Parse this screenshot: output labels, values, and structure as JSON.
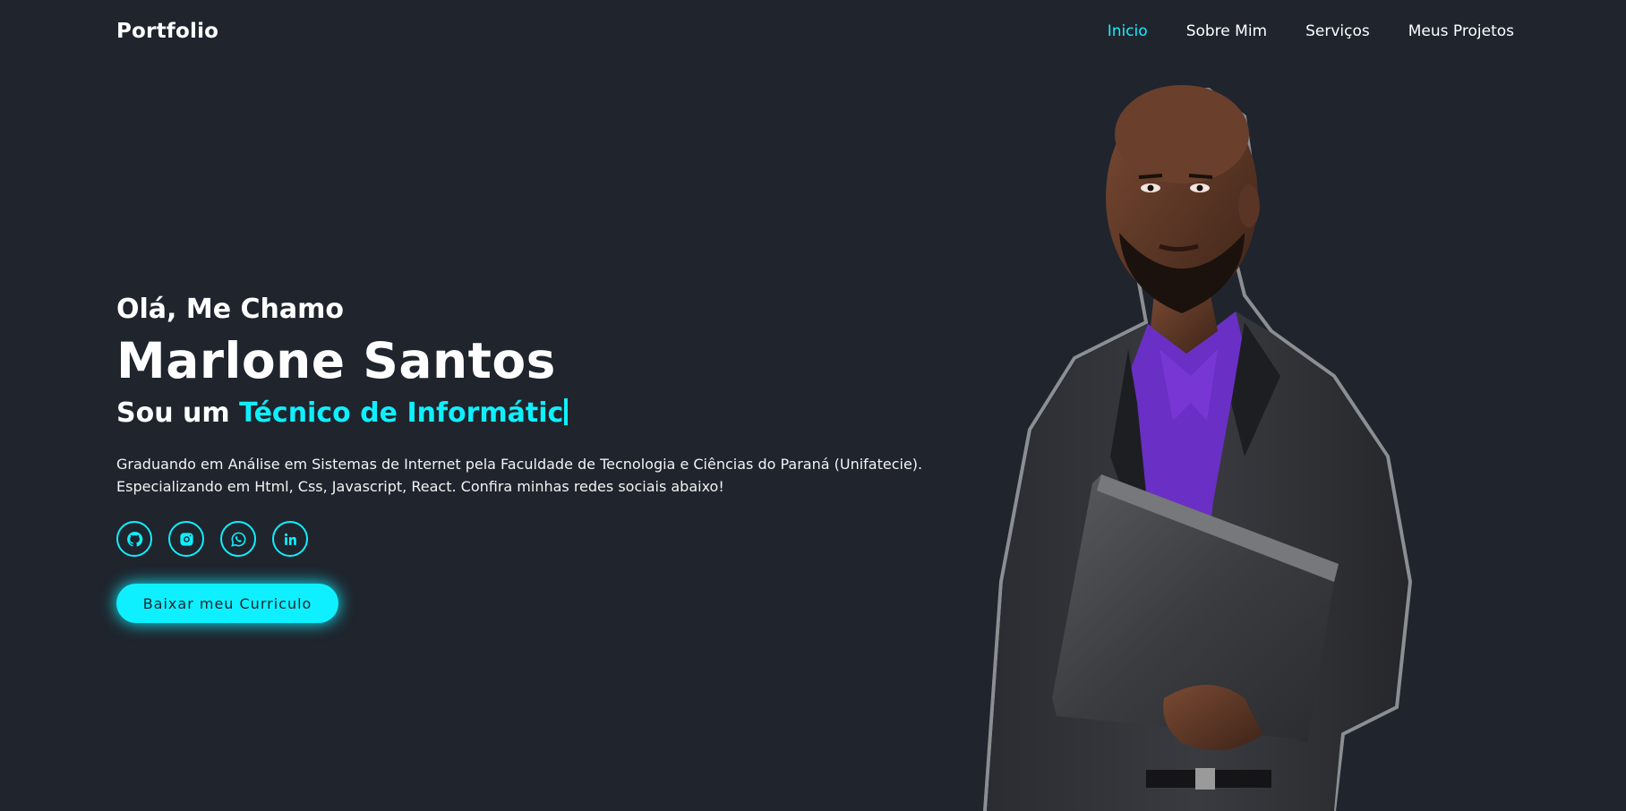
{
  "header": {
    "logo": "Portfolio",
    "nav": [
      {
        "label": "Inicio",
        "active": true
      },
      {
        "label": "Sobre Mim",
        "active": false
      },
      {
        "label": "Serviços",
        "active": false
      },
      {
        "label": "Meus Projetos",
        "active": false
      }
    ]
  },
  "hero": {
    "greeting": "Olá, Me Chamo",
    "name": "Marlone Santos",
    "role_prefix": "Sou um ",
    "role_typed": "Técnico de Informátic",
    "description_line1": "Graduando em Análise em Sistemas de Internet pela Faculdade de Tecnologia e Ciências do Paraná (Unifatecie).",
    "description_line2": "Especializando em Html, Css, Javascript, React. Confira minhas redes sociais abaixo!",
    "socials": [
      {
        "icon": "github-icon"
      },
      {
        "icon": "instagram-icon"
      },
      {
        "icon": "whatsapp-icon"
      },
      {
        "icon": "linkedin-icon"
      }
    ],
    "cta_label": "Baixar meu Curriculo"
  },
  "colors": {
    "background": "#1f242d",
    "accent": "#0ef0ff",
    "text": "#ffffff"
  }
}
